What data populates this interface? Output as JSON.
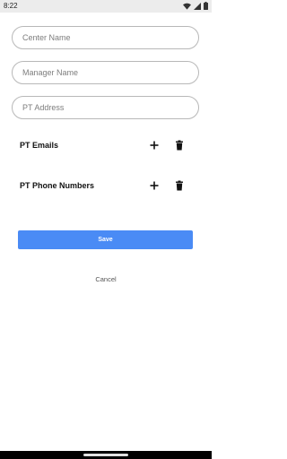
{
  "status_bar": {
    "time": "8:22",
    "icons": [
      "wifi-icon",
      "signal-icon",
      "battery-icon"
    ]
  },
  "form": {
    "center_name": {
      "value": "",
      "placeholder": "Center Name"
    },
    "manager_name": {
      "value": "",
      "placeholder": "Manager Name"
    },
    "pt_address": {
      "value": "",
      "placeholder": "PT Address"
    }
  },
  "lists": {
    "emails": {
      "label": "PT Emails",
      "add_icon": "plus-icon",
      "delete_icon": "trash-icon"
    },
    "phones": {
      "label": "PT Phone Numbers",
      "add_icon": "plus-icon",
      "delete_icon": "trash-icon"
    }
  },
  "actions": {
    "save_label": "Save",
    "cancel_label": "Cancel"
  },
  "colors": {
    "primary": "#4a8bf5",
    "field_border": "#b8b8b8",
    "status_bar": "#ececec"
  }
}
